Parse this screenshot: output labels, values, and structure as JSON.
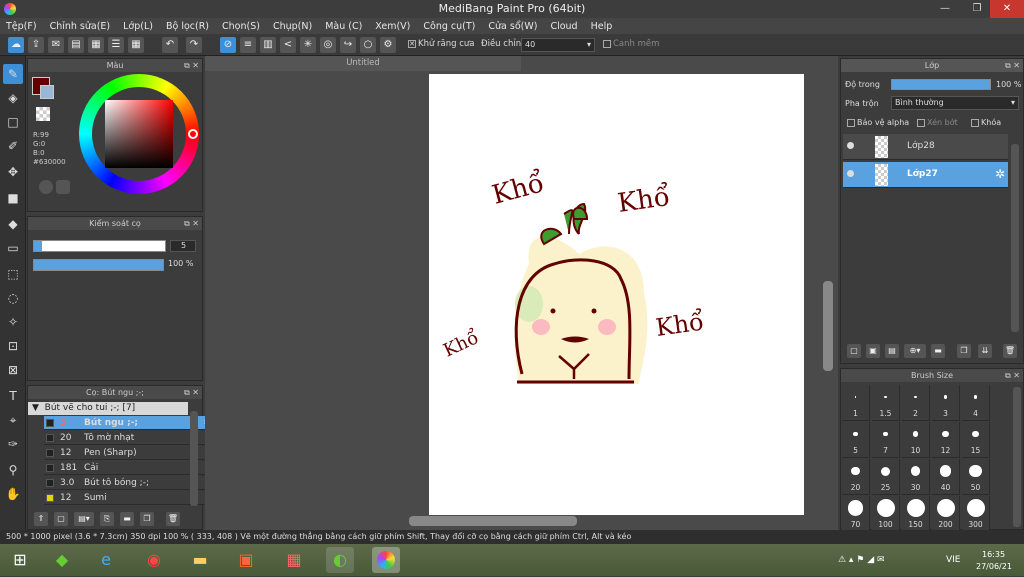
{
  "window": {
    "title": "MediBang Paint Pro (64bit)"
  },
  "menu": [
    "Tệp(F)",
    "Chỉnh sửa(E)",
    "Lớp(L)",
    "Bộ lọc(R)",
    "Chọn(S)",
    "Chụp(N)",
    "Màu (C)",
    "Xem(V)",
    "Công cụ(T)",
    "Cửa sổ(W)",
    "Cloud",
    "Help"
  ],
  "toolbar": {
    "antialias_label": "Khử răng cưa",
    "adjust_label": "Điều chỉnh",
    "adjust_value": "40",
    "snap_label": "Canh mềm"
  },
  "color_panel": {
    "title": "Màu",
    "r": "R:99",
    "g": "G:0",
    "b": "B:0",
    "hex": "#630000",
    "primary_color": "#630000"
  },
  "brush_control": {
    "title": "Kiểm soát cọ",
    "size": "5",
    "opacity": "100 %"
  },
  "brush_panel": {
    "title": "Cọ: Bút ngu ;-;",
    "group": "Bút vẽ cho tui ;-; [7]",
    "items": [
      {
        "size": "5",
        "name": "Bút ngu ;-;",
        "selected": true,
        "swatch": "#222222"
      },
      {
        "size": "20",
        "name": "Tô mờ nhạt",
        "selected": false,
        "swatch": "#222222"
      },
      {
        "size": "12",
        "name": "Pen (Sharp)",
        "selected": false,
        "swatch": "#222222"
      },
      {
        "size": "181",
        "name": "Cải",
        "selected": false,
        "swatch": "#222222"
      },
      {
        "size": "3.0",
        "name": "Bút tô bóng ;-;",
        "selected": false,
        "swatch": "#222222"
      },
      {
        "size": "12",
        "name": "Sumi",
        "selected": false,
        "swatch": "#e8d400"
      }
    ]
  },
  "document": {
    "tab": "Untitled",
    "text1": "Khổ",
    "text2": "Khổ",
    "text3": "Khổ",
    "text4": "Khổ"
  },
  "layer_panel": {
    "title": "Lớp",
    "opacity_label": "Độ trong",
    "opacity_value": "100 %",
    "opacity": 1.0,
    "blend_label": "Pha trộn",
    "blend_value": "Bình thường",
    "protect_alpha": "Bảo vệ alpha",
    "clip": "Xén bớt",
    "lock": "Khóa",
    "layers": [
      {
        "name": "Lớp28",
        "selected": false
      },
      {
        "name": "Lớp27",
        "selected": true
      }
    ]
  },
  "brush_size_panel": {
    "title": "Brush Size",
    "sizes": [
      "1",
      "1.5",
      "2",
      "3",
      "4",
      "5",
      "7",
      "10",
      "12",
      "15",
      "20",
      "25",
      "30",
      "40",
      "50",
      "70",
      "100",
      "150",
      "200",
      "300"
    ]
  },
  "status": "500 * 1000 pixel   (3.6 * 7.3cm)   350 dpi   100 %   ( 333, 408 )   Vẽ một đường thẳng bằng cách giữ phím Shift, Thay đổi cỡ cọ bằng cách giữ phím Ctrl, Alt và kéo",
  "taskbar": {
    "lang": "VIE",
    "time": "16:35",
    "date": "27/06/21"
  }
}
